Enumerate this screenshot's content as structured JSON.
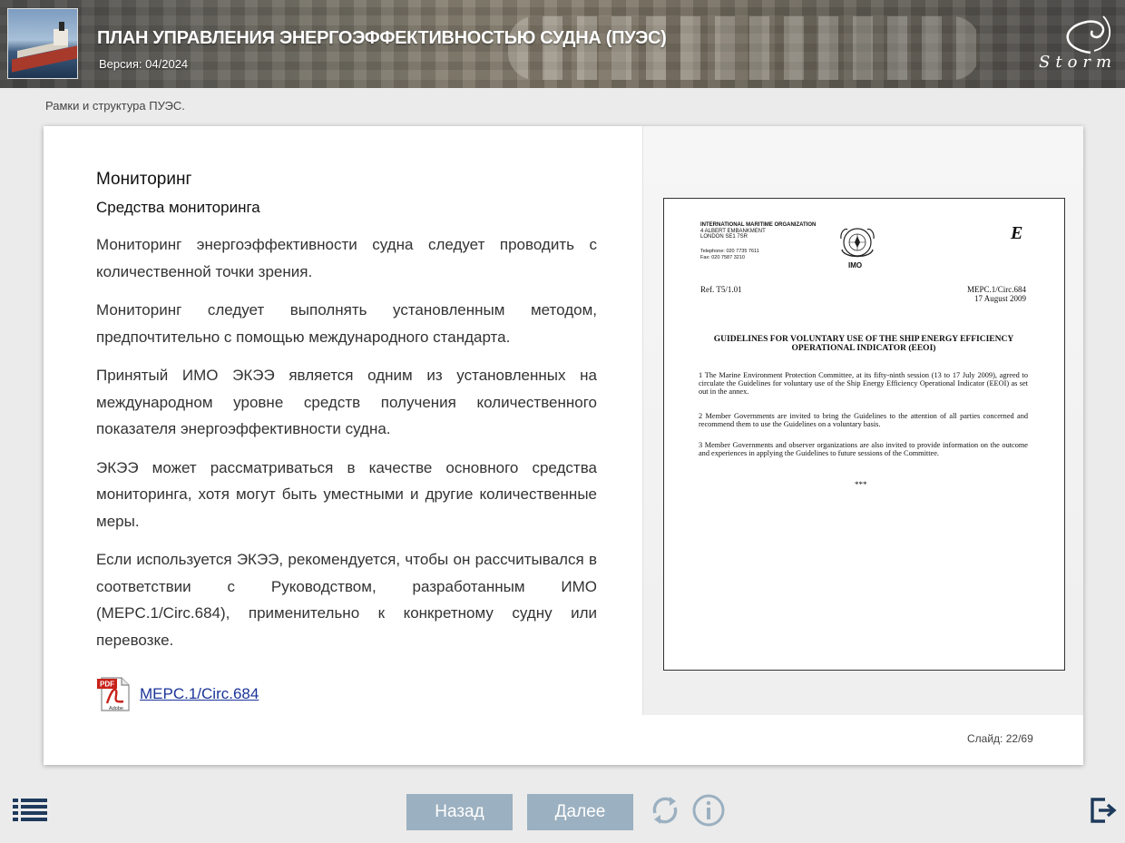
{
  "header": {
    "title": "ПЛАН УПРАВЛЕНИЯ ЭНЕРГОЭФФЕКТИВНОСТЬЮ СУДНА (ПУЭС)",
    "version": "Версия: 04/2024",
    "logo_text": "Storm"
  },
  "breadcrumb": "Рамки и структура ПУЭС.",
  "slide": {
    "title": "Мониторинг",
    "subtitle": "Средства мониторинга",
    "paragraphs": [
      "Мониторинг энергоэффективности судна следует проводить с количественной точки зрения.",
      "Мониторинг следует выполнять установленным методом, предпочтительно с помощью международного стандарта.",
      "Принятый ИМО ЭКЭЭ является одним из установленных на международном уровне средств получения количественного показателя энергоэффективности судна.",
      "ЭКЭЭ может рассматриваться в качестве основного средства мониторинга, хотя могут быть уместными и другие количественные меры.",
      "Если используется ЭКЭЭ, рекомендуется, чтобы он рассчитывался в соответствии с Руководством, разработанным ИМО (MEPC.1/Circ.684), применительно к конкретному судну или перевозке."
    ],
    "pdf_link": "MEPC.1/Circ.684",
    "pdf_icon_top": "PDF",
    "pdf_icon_bottom": "Adobe"
  },
  "document": {
    "org_name": "INTERNATIONAL MARITIME ORGANIZATION",
    "address_1": "4 ALBERT EMBANKMENT",
    "address_2": "LONDON SE1 7SR",
    "telephone": "Telephone:   020 7735 7611",
    "fax": "Fax:            020 7587 3210",
    "imo": "IMO",
    "lang": "E",
    "ref": "Ref. T5/1.01",
    "code": "MEPC.1/Circ.684",
    "date": "17 August 2009",
    "heading": "GUIDELINES FOR VOLUNTARY USE OF THE SHIP ENERGY EFFICIENCY OPERATIONAL INDICATOR (EEOI)",
    "p1": "1        The Marine Environment Protection Committee, at its fifty-ninth session (13 to 17 July 2009), agreed to circulate the Guidelines for voluntary use of the Ship Energy Efficiency Operational Indicator (EEOI) as set out in the annex.",
    "p2": "2        Member Governments are invited to bring the Guidelines to the attention of all parties concerned and recommend them to use the Guidelines on a voluntary basis.",
    "p3": "3        Member Governments and observer organizations are also invited to provide information on the outcome and experiences in applying the Guidelines to future sessions of the Committee.",
    "stars": "***"
  },
  "slide_counter": "Слайд:  22/69",
  "footer": {
    "back_label": "Назад",
    "next_label": "Далее"
  },
  "colors": {
    "nav_button": "#9bb0c0",
    "icon": "#9bb0c0",
    "menu_icon": "#1e3a5c",
    "link": "#1a3399"
  },
  "icons": [
    "menu-list-icon",
    "refresh-icon",
    "info-icon",
    "exit-icon",
    "pdf-icon",
    "imo-emblem-icon"
  ]
}
